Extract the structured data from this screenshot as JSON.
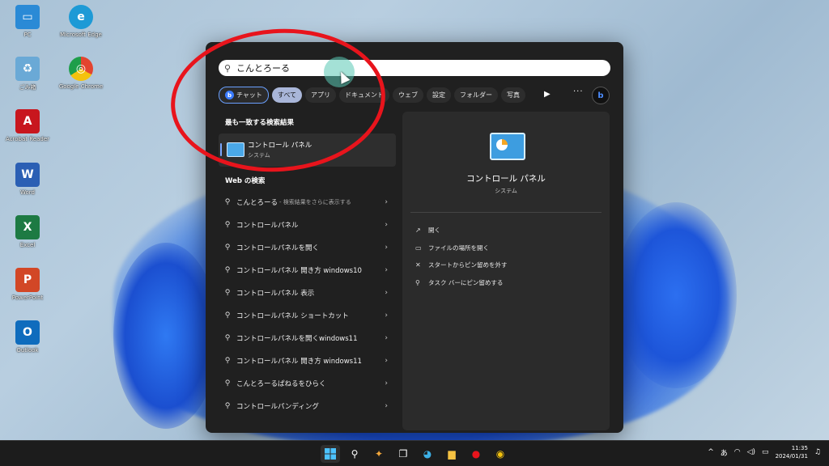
{
  "desktop": {
    "icons": [
      {
        "label": "PC",
        "glyph": "▭",
        "color": "#2a8ad6"
      },
      {
        "label": "Microsoft Edge",
        "glyph": "e",
        "color": "#1d9ad6"
      },
      {
        "label": "ごみ箱",
        "glyph": "♻",
        "color": "#6aa9d6"
      },
      {
        "label": "Google Chrome",
        "glyph": "◎",
        "color": "#e3442f"
      },
      {
        "label": "Acrobat Reader",
        "glyph": "A",
        "color": "#c8161e"
      },
      {
        "label": "Word",
        "glyph": "W",
        "color": "#2b5fb4"
      },
      {
        "label": "Excel",
        "glyph": "X",
        "color": "#1d7a43"
      },
      {
        "label": "PowerPoint",
        "glyph": "P",
        "color": "#d24726"
      },
      {
        "label": "Outlook",
        "glyph": "O",
        "color": "#0f6cbd"
      }
    ]
  },
  "search": {
    "query": "こんとろーる",
    "search_icon": "search-icon"
  },
  "filters": {
    "chat": "チャット",
    "all": "すべて",
    "apps": "アプリ",
    "documents": "ドキュメント",
    "web": "ウェブ",
    "settings": "設定",
    "folders": "フォルダー",
    "photos": "写真",
    "play_icon": "▶",
    "more": "···",
    "bing": "b"
  },
  "best_match": {
    "heading": "最も一致する検索結果",
    "title": "コントロール パネル",
    "subtitle": "システム"
  },
  "web_search": {
    "heading": "Web の検索",
    "first_extra": "- 検索結果をさらに表示する",
    "items": [
      "こんとろーる",
      "コントロールパネル",
      "コントロールパネルを開く",
      "コントロールパネル 開き方 windows10",
      "コントロールパネル 表示",
      "コントロールパネル ショートカット",
      "コントロールパネルを開くwindows11",
      "コントロールパネル 開き方 windows11",
      "こんとろーるぱねるをひらく",
      "コントロールパンディング"
    ]
  },
  "preview": {
    "title": "コントロール パネル",
    "subtitle": "システム",
    "actions": [
      {
        "icon": "↗",
        "label": "開く"
      },
      {
        "icon": "▭",
        "label": "ファイルの場所を開く"
      },
      {
        "icon": "✕",
        "label": "スタートからピン留めを外す"
      },
      {
        "icon": "⚲",
        "label": "タスク バーにピン留めする"
      }
    ]
  },
  "taskbar": {
    "time": "11:35",
    "date": "2024/01/31",
    "ime": "あ",
    "tray_chevron": "^"
  }
}
